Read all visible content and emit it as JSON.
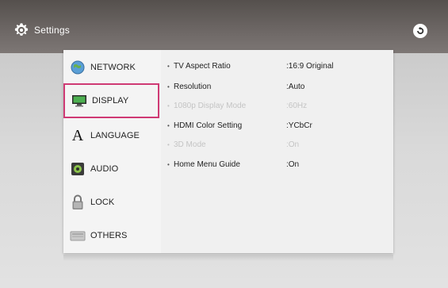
{
  "header": {
    "title": "Settings"
  },
  "icons": {
    "settings": "gear-icon",
    "back": "back-icon"
  },
  "sidebar": {
    "items": [
      {
        "label": "NETWORK",
        "icon": "globe-icon"
      },
      {
        "label": "DISPLAY",
        "icon": "monitor-icon",
        "selected": true
      },
      {
        "label": "LANGUAGE",
        "icon": "letter-a-icon"
      },
      {
        "label": "AUDIO",
        "icon": "speaker-icon"
      },
      {
        "label": "LOCK",
        "icon": "padlock-icon"
      },
      {
        "label": "OTHERS",
        "icon": "drive-icon"
      }
    ]
  },
  "settings": {
    "rows": [
      {
        "label": "TV Aspect Ratio",
        "value": ":16:9 Original",
        "enabled": true
      },
      {
        "label": "Resolution",
        "value": ":Auto",
        "enabled": true
      },
      {
        "label": "1080p Display Mode",
        "value": ":60Hz",
        "enabled": false
      },
      {
        "label": "HDMI Color Setting",
        "value": ":YCbCr",
        "enabled": true
      },
      {
        "label": "3D Mode",
        "value": ":On",
        "enabled": false
      },
      {
        "label": "Home Menu Guide",
        "value": ":On",
        "enabled": true
      }
    ]
  },
  "colors": {
    "selection_border": "#cf3a74",
    "header_bg": "#6e6866",
    "disabled_text": "#c4c4c4"
  }
}
